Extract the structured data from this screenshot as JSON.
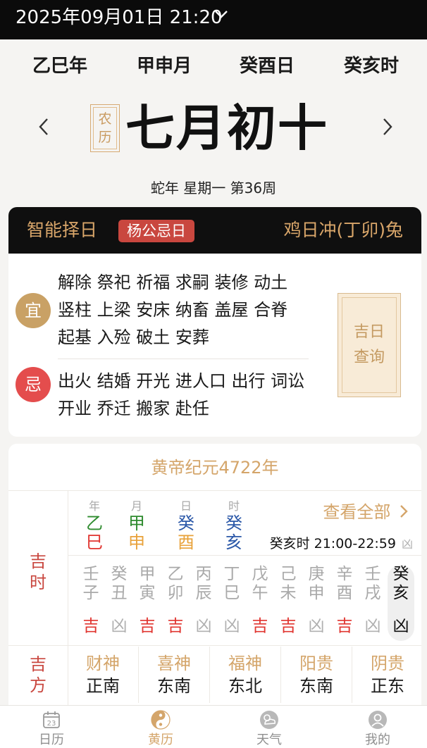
{
  "status_bar": {
    "datetime": "2025年09月01日 21:20"
  },
  "ganzhi": {
    "year": "乙巳年",
    "month": "甲申月",
    "day": "癸酉日",
    "hour": "癸亥时"
  },
  "lunar": {
    "tag_line1": "农",
    "tag_line2": "历",
    "date": "七月初十",
    "info": "蛇年 星期一 第36周"
  },
  "card": {
    "title": "智能择日",
    "badge": "杨公忌日",
    "chong": "鸡日冲(丁卯)兔",
    "yi_label": "宜",
    "yi_text": "解除 祭祀 祈福 求嗣 装修 动土 竖柱 上梁 安床 纳畜 盖屋 合脊 起基 入殓 破土 安葬",
    "ji_label": "忌",
    "ji_text": "出火 结婚 开光 进人口 出行 词讼 开业 乔迁 搬家 赴任",
    "jiri_line1": "吉日",
    "jiri_line2": "查询"
  },
  "era": "黄帝纪元4722年",
  "pillars": [
    {
      "label": "年",
      "stem": "乙",
      "branch": "巳",
      "stem_color": "#2e8b2e",
      "branch_color": "#e0342f"
    },
    {
      "label": "月",
      "stem": "甲",
      "branch": "申",
      "stem_color": "#2e8b2e",
      "branch_color": "#e8a23a"
    },
    {
      "label": "日",
      "stem": "癸",
      "branch": "酉",
      "stem_color": "#2b58a8",
      "branch_color": "#e8a23a"
    },
    {
      "label": "时",
      "stem": "癸",
      "branch": "亥",
      "stem_color": "#2b58a8",
      "branch_color": "#2b58a8"
    }
  ],
  "view_all": "查看全部",
  "current_hour": {
    "name": "癸亥时 21:00-22:59",
    "status": "凶"
  },
  "jishi_label": [
    "吉",
    "时"
  ],
  "hours": [
    {
      "stem": "壬",
      "branch": "子",
      "status": "吉"
    },
    {
      "stem": "癸",
      "branch": "丑",
      "status": "凶"
    },
    {
      "stem": "甲",
      "branch": "寅",
      "status": "吉"
    },
    {
      "stem": "乙",
      "branch": "卯",
      "status": "吉"
    },
    {
      "stem": "丙",
      "branch": "辰",
      "status": "凶"
    },
    {
      "stem": "丁",
      "branch": "巳",
      "status": "凶"
    },
    {
      "stem": "戊",
      "branch": "午",
      "status": "吉"
    },
    {
      "stem": "己",
      "branch": "未",
      "status": "吉"
    },
    {
      "stem": "庚",
      "branch": "申",
      "status": "凶"
    },
    {
      "stem": "辛",
      "branch": "酉",
      "status": "吉"
    },
    {
      "stem": "壬",
      "branch": "戌",
      "status": "凶"
    },
    {
      "stem": "癸",
      "branch": "亥",
      "status": "凶",
      "current": true
    }
  ],
  "jifang_label": [
    "吉",
    "方"
  ],
  "directions": [
    {
      "label": "财神",
      "value": "正南"
    },
    {
      "label": "喜神",
      "value": "东南"
    },
    {
      "label": "福神",
      "value": "东北"
    },
    {
      "label": "阳贵",
      "value": "东南"
    },
    {
      "label": "阴贵",
      "value": "正东"
    }
  ],
  "tabs": [
    {
      "label": "日历",
      "icon": "calendar-icon",
      "day": "23"
    },
    {
      "label": "黄历",
      "icon": "yinyang-icon",
      "active": true
    },
    {
      "label": "天气",
      "icon": "weather-icon"
    },
    {
      "label": "我的",
      "icon": "profile-icon"
    }
  ],
  "colors": {
    "gold": "#d4a56a",
    "red": "#c9473f",
    "good": "#e0342f",
    "bad": "#b0b0b0"
  }
}
